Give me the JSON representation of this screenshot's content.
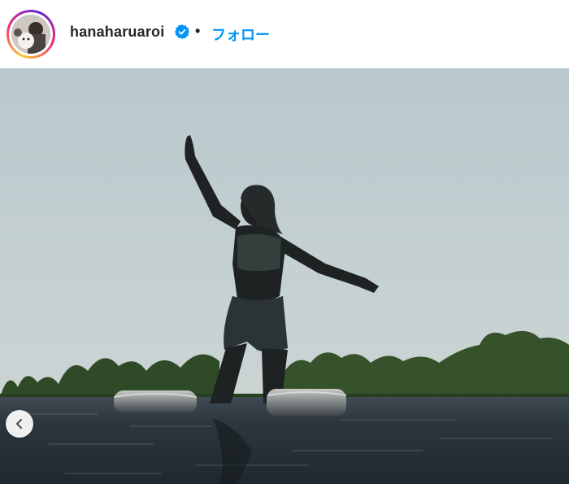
{
  "post": {
    "username": "hanaharuaroi",
    "verified": true,
    "separator": "•",
    "follow_label": "フォロー"
  },
  "icons": {
    "verified": "verified-badge-icon",
    "prev": "chevron-left-icon"
  },
  "colors": {
    "follow": "#0095f6",
    "verified": "#0095f6",
    "text": "#262626"
  }
}
